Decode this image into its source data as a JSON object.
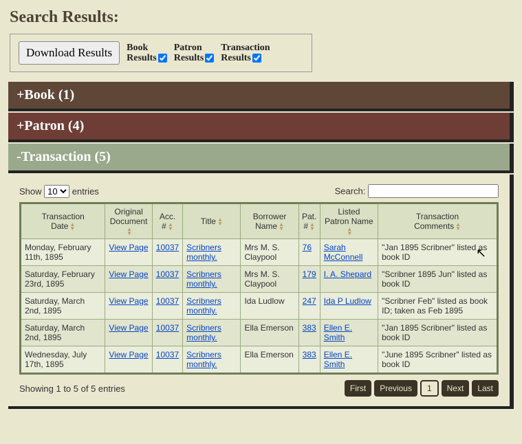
{
  "page_title": "Search Results:",
  "download": {
    "button": "Download Results",
    "checks": [
      {
        "line1": "Book",
        "line2": "Results",
        "checked": true
      },
      {
        "line1": "Patron",
        "line2": "Results",
        "checked": true
      },
      {
        "line1": "Transaction",
        "line2": "Results",
        "checked": true
      }
    ]
  },
  "accordions": {
    "book": "+Book (1)",
    "patron": "+Patron (4)",
    "transaction": "-Transaction (5)"
  },
  "table_controls": {
    "show_label_pre": "Show",
    "show_value": "10",
    "show_label_post": "entries",
    "search_label": "Search:"
  },
  "columns": [
    "Transaction Date",
    "Original Document",
    "Acc. #",
    "Title",
    "Borrower Name",
    "Pat. #",
    "Listed Patron Name",
    "Transaction Comments"
  ],
  "rows": [
    {
      "date": "Monday, February 11th, 1895",
      "doc": "View Page",
      "acc": "10037",
      "title": "Scribners monthly.",
      "borrower": "Mrs M. S. Claypool",
      "pat": "76",
      "patron": "Sarah McConnell",
      "comments": "\"Jan 1895 Scribner\" listed as book ID"
    },
    {
      "date": "Saturday, February 23rd, 1895",
      "doc": "View Page",
      "acc": "10037",
      "title": "Scribners monthly.",
      "borrower": "Mrs M. S. Claypool",
      "pat": "179",
      "patron": "I. A. Shepard",
      "comments": "\"Scribner 1895 Jun\" listed as book ID"
    },
    {
      "date": "Saturday, March 2nd, 1895",
      "doc": "View Page",
      "acc": "10037",
      "title": "Scribners monthly.",
      "borrower": "Ida Ludlow",
      "pat": "247",
      "patron": "Ida P Ludlow",
      "comments": "\"Scribner Feb\" listed as book ID; taken as Feb 1895"
    },
    {
      "date": "Saturday, March 2nd, 1895",
      "doc": "View Page",
      "acc": "10037",
      "title": "Scribners monthly.",
      "borrower": "Ella Emerson",
      "pat": "383",
      "patron": "Ellen E. Smith",
      "comments": "\"Jan 1895 Scribner\" listed as book ID"
    },
    {
      "date": "Wednesday, July 17th, 1895",
      "doc": "View Page",
      "acc": "10037",
      "title": "Scribners monthly.",
      "borrower": "Ella Emerson",
      "pat": "383",
      "patron": "Ellen E. Smith",
      "comments": "\"June 1895 Scribner\" listed as book ID"
    }
  ],
  "info": "Showing 1 to 5 of 5 entries",
  "pager": {
    "first": "First",
    "prev": "Previous",
    "page": "1",
    "next": "Next",
    "last": "Last"
  }
}
